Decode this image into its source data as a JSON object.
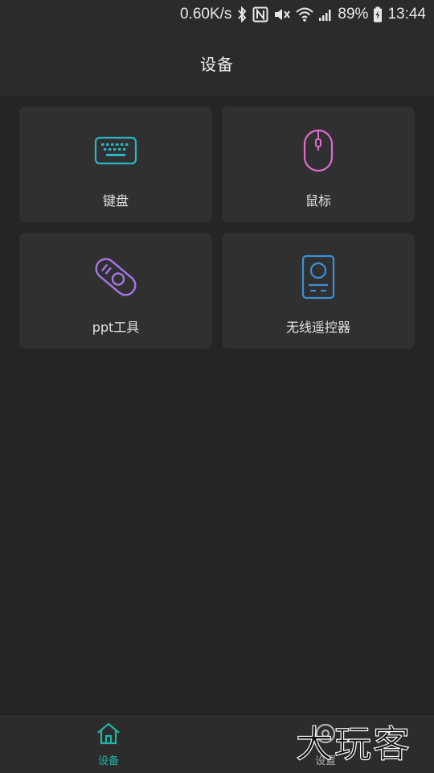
{
  "status_bar": {
    "network_speed": "0.60K/s",
    "battery": "89%",
    "time": "13:44",
    "icons": [
      "bluetooth-icon",
      "nfc-icon",
      "mute-icon",
      "wifi-icon",
      "signal-icon",
      "battery-icon"
    ]
  },
  "header": {
    "title": "设备"
  },
  "devices": [
    {
      "label": "键盘",
      "icon": "keyboard-icon",
      "color": "#29b6c8"
    },
    {
      "label": "鼠标",
      "icon": "mouse-icon",
      "color": "#e06ad0"
    },
    {
      "label": "ppt工具",
      "icon": "ppt-remote-icon",
      "color": "#a676e8"
    },
    {
      "label": "无线遥控器",
      "icon": "remote-control-icon",
      "color": "#3a8fd8"
    }
  ],
  "bottom_nav": {
    "items": [
      {
        "label": "设备",
        "icon": "home-icon",
        "active": true
      },
      {
        "label": "设置",
        "icon": "settings-icon",
        "active": false
      }
    ],
    "active_color": "#20b5a6"
  },
  "watermark": {
    "text": "大玩客"
  }
}
